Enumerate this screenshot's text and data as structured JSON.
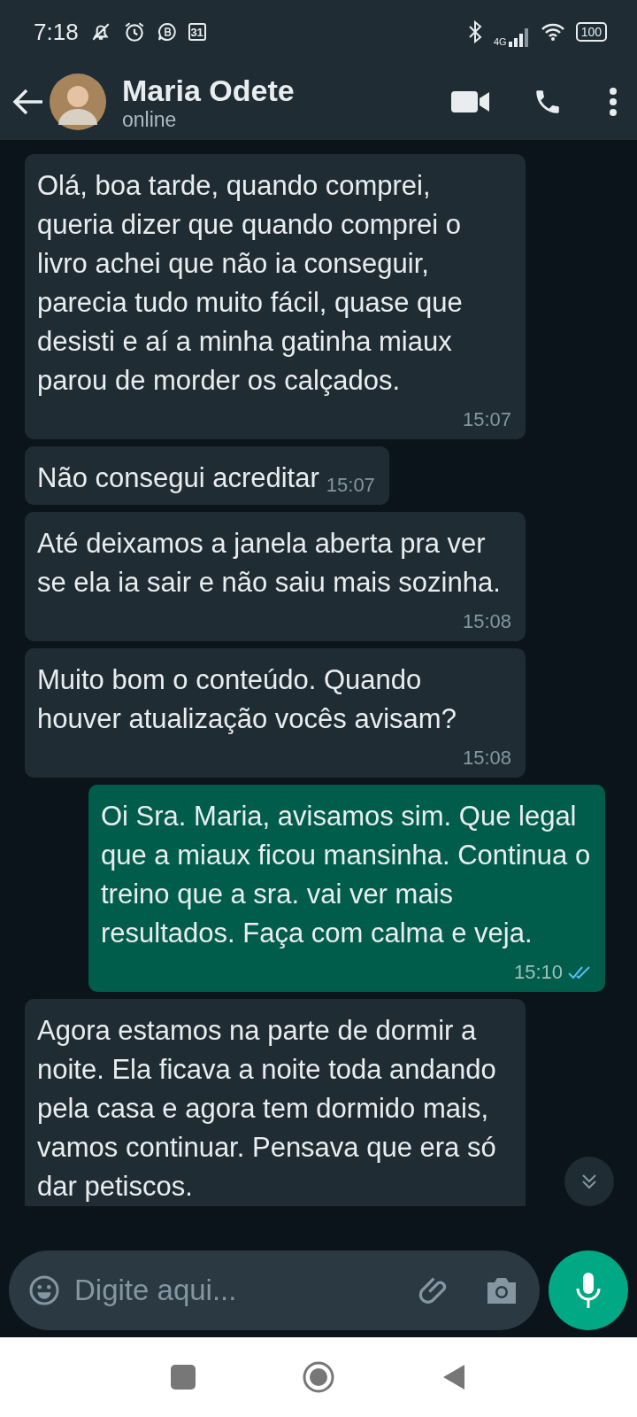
{
  "status_bar": {
    "time": "7:18",
    "calendar_day": "31",
    "battery": "100",
    "network": "4G"
  },
  "header": {
    "name": "Maria Odete",
    "status": "online"
  },
  "messages": [
    {
      "kind": "in",
      "text": "Olá, boa tarde, quando comprei, queria dizer que quando comprei o livro achei que não ia conseguir, parecia tudo muito fácil, quase que desisti e aí a minha gatinha miaux parou de morder os calçados.",
      "time": "15:07"
    },
    {
      "kind": "in",
      "text": "Não consegui acreditar",
      "time": "15:07"
    },
    {
      "kind": "in",
      "text": "Até deixamos a janela aberta pra ver se ela ia sair e não saiu mais sozinha.",
      "time": "15:08"
    },
    {
      "kind": "in",
      "text": "Muito bom o conteúdo. Quando houver atualização vocês avisam?",
      "time": "15:08"
    },
    {
      "kind": "out",
      "text": "Oi Sra. Maria, avisamos sim. Que legal que a miaux ficou mansinha. Continua o treino que a sra. vai ver mais resultados. Faça com calma e veja.",
      "time": "15:10",
      "read": true
    },
    {
      "kind": "in",
      "text": "Agora estamos na parte de dormir a noite. Ela ficava a noite toda andando pela casa e agora tem dormido mais, vamos continuar. Pensava que era só dar petiscos."
    }
  ],
  "composer": {
    "placeholder": "Digite aqui..."
  }
}
